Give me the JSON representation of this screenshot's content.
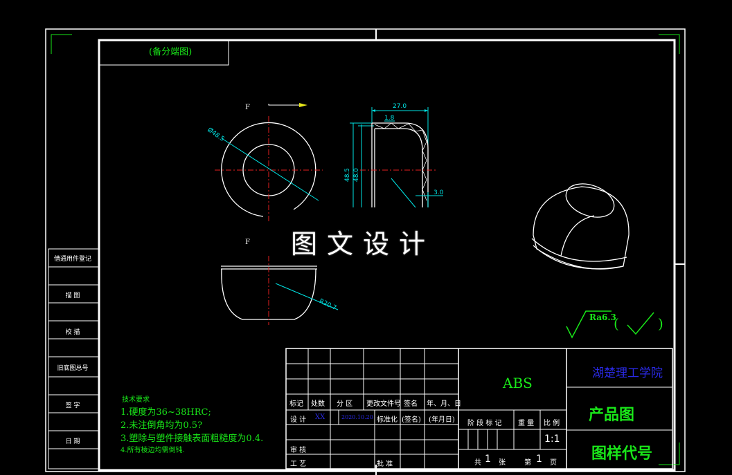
{
  "view_label": "(备分端图)",
  "dimensions": {
    "width_27": "27.0",
    "wall_1_8": "1.8",
    "h_48_5": "48.5",
    "h_48_0": "48.0",
    "edge_3_0": "3.0",
    "dia_48_5": "Ø48.5",
    "radius_20_7": "R20.7"
  },
  "section_marks": {
    "top": "F",
    "bottom": "F"
  },
  "watermark": "图文设计",
  "surface_finish": {
    "value": "Ra6.3",
    "paren_open": "(",
    "paren_close": ")"
  },
  "left_column": {
    "labels": [
      "借通用件登记",
      "描  图",
      "校  描",
      "旧底图总号",
      "签  字",
      "日  期"
    ]
  },
  "tech_requirements": {
    "heading": "技术要求",
    "items": [
      "1.硬度为36~38HRC;",
      "2.未注倒角均为0.5?",
      "3.塑除与塑件接触表面粗糙度为0.4.",
      "4.所有棱边均需倒钝."
    ]
  },
  "title_block": {
    "material": "ABS",
    "school": "湖楚理工学院",
    "drawing_title": "产品图",
    "drawing_code": "图样代号",
    "scale": "1:1",
    "row_headers": [
      "标记",
      "处数",
      "分 区",
      "更改文件号",
      "签名",
      "年、月、日"
    ],
    "design_label": "设 计",
    "design_name": "XX",
    "design_date": "2020.10.20",
    "std_label": "标准化",
    "sign_label": "(签名)",
    "date_label": "(年月日)",
    "review_label": "审 核",
    "craft_label": "工 艺",
    "approve_label": "批 准",
    "stage_headers": [
      "阶 段 标 记",
      "重 量",
      "比 例"
    ],
    "sheets_total_label": "共",
    "sheets_total": "1",
    "sheets_unit": "张",
    "sheet_no_label": "第",
    "sheet_no": "1",
    "page_unit": "页"
  },
  "colors": {
    "line": "#ffffff",
    "green": "#19e619",
    "dimension": "#00e5e5",
    "center": "#e62020",
    "blue": "#2a2ae6"
  }
}
